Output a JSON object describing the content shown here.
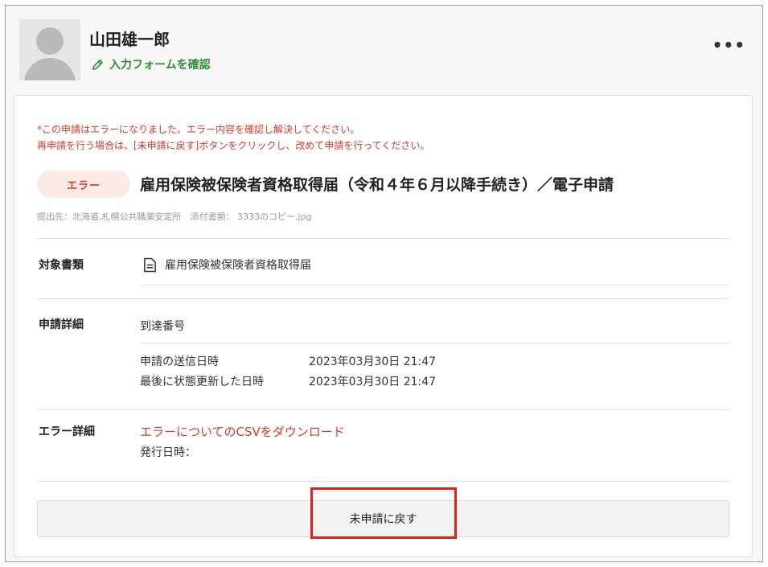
{
  "header": {
    "user_name": "山田雄一郎",
    "confirm_link": "入力フォームを確認",
    "more_label": "•••"
  },
  "card": {
    "error_message_line1": "*この申請はエラーになりました。エラー内容を確認し解決してください。",
    "error_message_line2": "再申請を行う場合は、[未申請に戻す]ボタンをクリックし、改めて申請を行ってください。",
    "status_badge": "エラー",
    "title": "雇用保険被保険者資格取得届（令和４年６月以降手続き）／電子申請",
    "sub_info": "提出先：北海道,札幌公共職業安定所　添付書類： 3333のコピー.jpg",
    "target_docs": {
      "label": "対象書類",
      "document_name": "雇用保険被保険者資格取得届"
    },
    "details": {
      "label": "申請詳細",
      "arrival_number_label": "到達番号",
      "sent_label": "申請の送信日時",
      "sent_value": "2023年03月30日 21:47",
      "updated_label": "最後に状態更新した日時",
      "updated_value": "2023年03月30日 21:47"
    },
    "error_details": {
      "label": "エラー詳細",
      "csv_link": "エラーについてのCSVをダウンロード",
      "issue_date_label": "発行日時："
    },
    "revert_button": "未申請に戻す"
  },
  "colors": {
    "error": "#d83a2a",
    "link_green": "#2e8b3e",
    "highlight": "#e0201a"
  }
}
